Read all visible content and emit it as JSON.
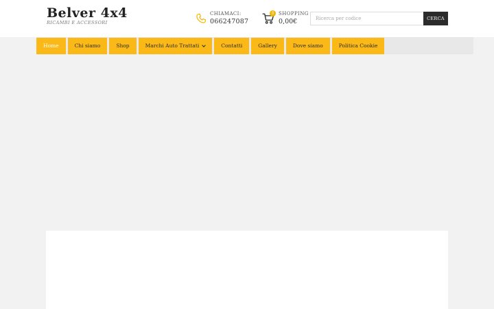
{
  "logo": {
    "title": "Belver 4x4",
    "subtitle": "Ricambi e accessori"
  },
  "contact": {
    "label": "Chiamaci:",
    "phone": "066247087",
    "icon": "phone-icon"
  },
  "cart": {
    "count": "0",
    "label": "Shopping",
    "total": "0,00€",
    "icon": "cart-icon"
  },
  "search": {
    "placeholder": "Ricerca per codice",
    "value": "",
    "button_label": "Cerca"
  },
  "nav": {
    "items": [
      {
        "label": "Home"
      },
      {
        "label": "Chi siamo"
      },
      {
        "label": "Shop"
      },
      {
        "label": "Marchi Auto Trattati"
      },
      {
        "label": "Contatti"
      },
      {
        "label": "Gallery"
      },
      {
        "label": "Dove siamo"
      },
      {
        "label": "Politica Cookie"
      }
    ]
  },
  "colors": {
    "accent": "#fbb917",
    "dark": "#2b2b2b",
    "background": "#f2f2f2"
  }
}
